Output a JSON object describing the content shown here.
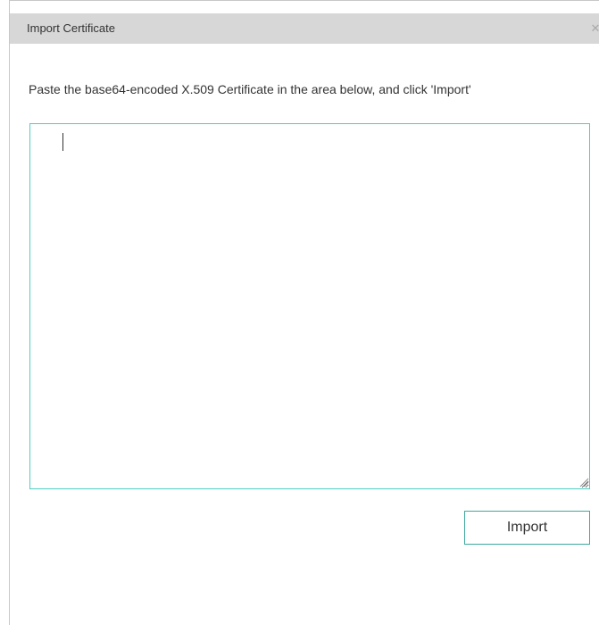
{
  "dialog": {
    "title": "Import Certificate",
    "close_icon": "close-icon",
    "instruction": "Paste the base64-encoded X.509 Certificate in the area below, and click 'Import'",
    "textarea_value": "",
    "import_label": "Import"
  },
  "colors": {
    "titlebar_bg": "#d7d7d7",
    "accent_border": "#4ecdc4",
    "button_border": "#3fa9a0"
  }
}
